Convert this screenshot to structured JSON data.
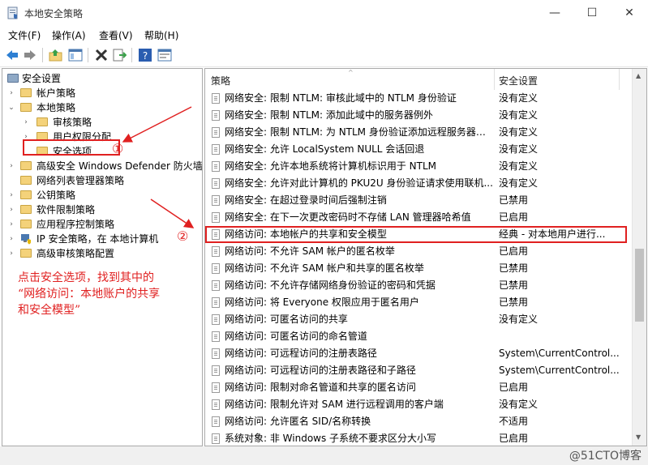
{
  "window": {
    "title": "本地安全策略",
    "controls": {
      "minimize": "—",
      "maximize": "☐",
      "close": "✕"
    }
  },
  "menu": [
    "文件(F)",
    "操作(A)",
    "查看(V)",
    "帮助(H)"
  ],
  "tree": [
    {
      "label": "安全设置",
      "level": 0,
      "expander": "",
      "root": true
    },
    {
      "label": "帐户策略",
      "level": 1,
      "expander": "›"
    },
    {
      "label": "本地策略",
      "level": 1,
      "expander": "⌄"
    },
    {
      "label": "审核策略",
      "level": 2,
      "expander": "›"
    },
    {
      "label": "用户权限分配",
      "level": 2,
      "expander": "›"
    },
    {
      "label": "安全选项",
      "level": 2,
      "expander": ""
    },
    {
      "label": "高级安全 Windows Defender 防火墙",
      "level": 1,
      "expander": "›"
    },
    {
      "label": "网络列表管理器策略",
      "level": 1,
      "expander": ""
    },
    {
      "label": "公钥策略",
      "level": 1,
      "expander": "›"
    },
    {
      "label": "软件限制策略",
      "level": 1,
      "expander": "›"
    },
    {
      "label": "应用程序控制策略",
      "level": 1,
      "expander": "›"
    },
    {
      "label": "IP 安全策略，在 本地计算机",
      "level": 1,
      "expander": "›"
    },
    {
      "label": "高级审核策略配置",
      "level": 1,
      "expander": "›"
    }
  ],
  "annotations": {
    "circle1": "①",
    "circle2": "②",
    "instruction_line1": "点击安全选项，找到其中的",
    "instruction_line2": "“网络访问：本地账户的共享",
    "instruction_line3": "和安全模型”",
    "color": "#e02020"
  },
  "columns": {
    "policy": "策略",
    "setting": "安全设置"
  },
  "policies": [
    {
      "name": "网络安全: 限制 NTLM: 审核此域中的 NTLM 身份验证",
      "setting": "没有定义"
    },
    {
      "name": "网络安全: 限制 NTLM: 添加此域中的服务器例外",
      "setting": "没有定义"
    },
    {
      "name": "网络安全: 限制 NTLM: 为 NTLM 身份验证添加远程服务器例外",
      "setting": "没有定义"
    },
    {
      "name": "网络安全: 允许 LocalSystem NULL 会话回退",
      "setting": "没有定义"
    },
    {
      "name": "网络安全: 允许本地系统将计算机标识用于 NTLM",
      "setting": "没有定义"
    },
    {
      "name": "网络安全: 允许对此计算机的 PKU2U 身份验证请求使用联机...",
      "setting": "没有定义"
    },
    {
      "name": "网络安全: 在超过登录时间后强制注销",
      "setting": "已禁用"
    },
    {
      "name": "网络安全: 在下一次更改密码时不存储 LAN 管理器哈希值",
      "setting": "已启用"
    },
    {
      "name": "网络访问: 本地帐户的共享和安全模型",
      "setting": "经典 - 对本地用户进行...",
      "highlight": true
    },
    {
      "name": "网络访问: 不允许 SAM 帐户的匿名枚举",
      "setting": "已启用"
    },
    {
      "name": "网络访问: 不允许 SAM 帐户和共享的匿名枚举",
      "setting": "已禁用"
    },
    {
      "name": "网络访问: 不允许存储网络身份验证的密码和凭据",
      "setting": "已禁用"
    },
    {
      "name": "网络访问: 将 Everyone 权限应用于匿名用户",
      "setting": "已禁用"
    },
    {
      "name": "网络访问: 可匿名访问的共享",
      "setting": "没有定义"
    },
    {
      "name": "网络访问: 可匿名访问的命名管道",
      "setting": ""
    },
    {
      "name": "网络访问: 可远程访问的注册表路径",
      "setting": "System\\CurrentControl..."
    },
    {
      "name": "网络访问: 可远程访问的注册表路径和子路径",
      "setting": "System\\CurrentControl..."
    },
    {
      "name": "网络访问: 限制对命名管道和共享的匿名访问",
      "setting": "已启用"
    },
    {
      "name": "网络访问: 限制允许对 SAM 进行远程调用的客户端",
      "setting": "没有定义"
    },
    {
      "name": "网络访问: 允许匿名 SID/名称转换",
      "setting": "不适用"
    },
    {
      "name": "系统对象: 非 Windows 子系统不要求区分大小写",
      "setting": "已启用"
    }
  ],
  "watermark": "@51CTO博客"
}
